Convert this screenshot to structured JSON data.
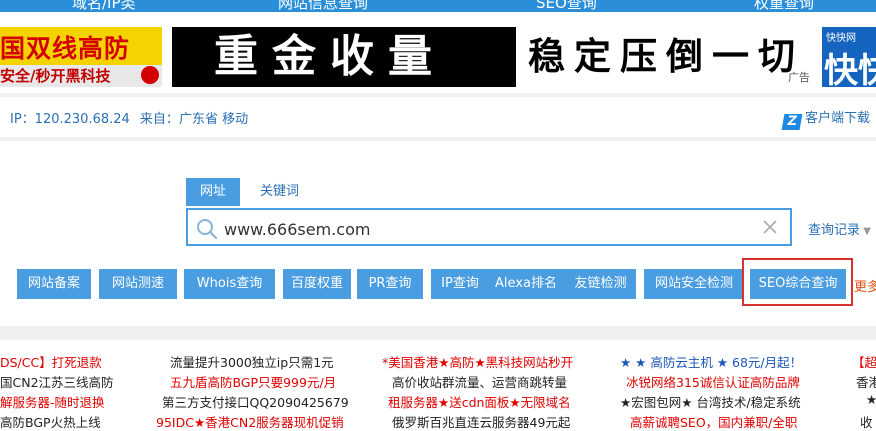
{
  "top_nav": [
    "域名/IP类",
    "网站信息查询",
    "SEO查询",
    "权重查询"
  ],
  "ads": {
    "ad1_line1": "国双线高防",
    "ad1_line2": "安全/秒开黑科技",
    "ad2_black": "重金收量",
    "ad2_white": "稳定压倒一切",
    "ad2_tag": "广告",
    "ad3_small": "快快网",
    "ad3_big": "快快"
  },
  "ip_bar": {
    "ip": "IP：120.230.68.24",
    "from_label": "来自：",
    "location": "广东省 移动",
    "client_icon": "Z",
    "client_download": "客户端下载"
  },
  "search": {
    "tab_active": "网址",
    "tab_inactive": "关键词",
    "value": "www.666sem.com",
    "history": "查询记录"
  },
  "tool_buttons": [
    "网站备案",
    "网站测速",
    "Whois查询",
    "百度权重",
    "PR查询",
    "IP查询",
    "Alexa排名",
    "友链检测",
    "网站安全检测",
    "SEO综合查询"
  ],
  "more": "更多",
  "link_rows": [
    [
      "DS/CC】打死退款",
      "流量提升3000独立ip只需1元",
      "*美国香港★高防★黑科技网站秒开",
      "★ ★ 高防云主机 ★ 68元/月起！",
      "【超"
    ],
    [
      "国CN2江苏三线高防",
      "五九盾高防BGP只要999元/月",
      "高价收站群流量、运营商跳转量",
      "冰锐网络315诚信认证高防品牌",
      "香港"
    ],
    [
      "解服务器-随时退换",
      "第三方支付接口QQ2090425679",
      "租服务器★送cdn面板★无限域名",
      "★宏图包网★ 台湾技术/稳定系统",
      "★"
    ],
    [
      "高防BGP火热上线",
      "95IDC★香港CN2服务器现机促销",
      "俄罗斯百兆直连云服务器49元起",
      "高薪诚聘SEO，国内兼职/全职",
      "收"
    ]
  ],
  "colors": {
    "accent": "#4a9de0",
    "link_blue": "#1a56b8",
    "link_red": "#e00000",
    "highlight_border": "#d93030"
  }
}
